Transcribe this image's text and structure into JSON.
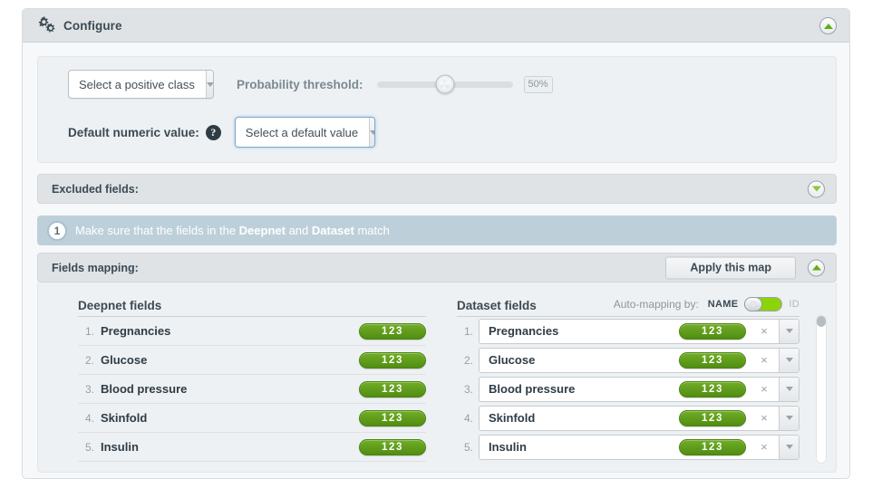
{
  "header": {
    "title": "Configure",
    "gear_icon": "gears-icon",
    "collapse_icon": "triangle-up-circle-icon"
  },
  "configure": {
    "positive_class": {
      "value": "Select a positive class",
      "caret_icon": "chevron-down-icon"
    },
    "probability_threshold": {
      "label": "Probability threshold:",
      "value": "50%",
      "slider_position_pct": 50
    },
    "default_numeric_value": {
      "label": "Default numeric value:",
      "help_icon": "question-mark-icon",
      "help_glyph": "?",
      "value": "Select a default value",
      "caret_icon": "chevron-down-icon"
    }
  },
  "excluded_fields": {
    "title": "Excluded fields:",
    "expand_icon": "triangle-down-circle-icon"
  },
  "banner": {
    "step": "1",
    "text_part1": "Make sure that the fields in the ",
    "bold1": "Deepnet",
    "text_part2": " and ",
    "bold2": "Dataset",
    "text_part3": " match"
  },
  "fields_mapping": {
    "title": "Fields mapping:",
    "apply_label": "Apply this map",
    "collapse_icon": "triangle-up-circle-icon",
    "left_column": {
      "title": "Deepnet fields",
      "rows": [
        {
          "num": "1.",
          "name": "Pregnancies",
          "badge": "123"
        },
        {
          "num": "2.",
          "name": "Glucose",
          "badge": "123"
        },
        {
          "num": "3.",
          "name": "Blood pressure",
          "badge": "123"
        },
        {
          "num": "4.",
          "name": "Skinfold",
          "badge": "123"
        },
        {
          "num": "5.",
          "name": "Insulin",
          "badge": "123"
        }
      ]
    },
    "right_column": {
      "title": "Dataset fields",
      "automapping_label": "Auto-mapping by:",
      "toggle_left_label": "NAME",
      "toggle_right_label": "ID",
      "toggle_state": "NAME",
      "clear_glyph": "×",
      "rows": [
        {
          "num": "1.",
          "name": "Pregnancies",
          "badge": "123"
        },
        {
          "num": "2.",
          "name": "Glucose",
          "badge": "123"
        },
        {
          "num": "3.",
          "name": "Blood pressure",
          "badge": "123"
        },
        {
          "num": "4.",
          "name": "Skinfold",
          "badge": "123"
        },
        {
          "num": "5.",
          "name": "Insulin",
          "badge": "123"
        }
      ]
    }
  },
  "colors": {
    "accent_green": "#8dd30a",
    "badge_green": "#5a9e20",
    "banner_blue": "#bdd0da",
    "header_gray": "#dfe3e6",
    "text_dark": "#2f3c46"
  }
}
